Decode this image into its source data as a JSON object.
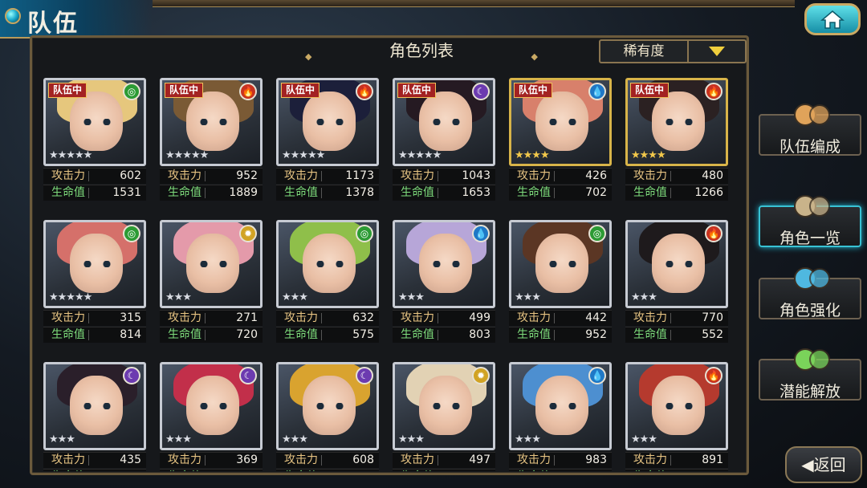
{
  "header": {
    "title": "队伍",
    "home_icon": "home-icon"
  },
  "panel": {
    "title": "角色列表",
    "sort": {
      "selected": "稀有度",
      "dropdown_icon": "triangle-down-icon"
    }
  },
  "labels": {
    "attack": "攻击力",
    "hp": "生命值",
    "in_team": "队伍中"
  },
  "colors": {
    "fire": "#c8321f",
    "wind": "#2c9b34",
    "water": "#1f78c6",
    "dark": "#6c3bb0",
    "light": "#d1a324"
  },
  "characters": [
    {
      "in_team": true,
      "element": "wind",
      "stars": 5,
      "frame": "silver",
      "atk": "602",
      "hp": "1531",
      "hair": "#e6c77d"
    },
    {
      "in_team": true,
      "element": "fire",
      "stars": 5,
      "frame": "silver",
      "atk": "952",
      "hp": "1889",
      "hair": "#7a5a35"
    },
    {
      "in_team": true,
      "element": "fire",
      "stars": 5,
      "frame": "silver",
      "atk": "1173",
      "hp": "1378",
      "hair": "#1c1f3a"
    },
    {
      "in_team": true,
      "element": "dark",
      "stars": 5,
      "frame": "silver",
      "atk": "1043",
      "hp": "1653",
      "hair": "#251a22"
    },
    {
      "in_team": true,
      "element": "water",
      "stars": 4,
      "frame": "gold",
      "atk": "426",
      "hp": "702",
      "hair": "#d8806b"
    },
    {
      "in_team": true,
      "element": "fire",
      "stars": 4,
      "frame": "gold",
      "atk": "480",
      "hp": "1266",
      "hair": "#2b2122"
    },
    {
      "in_team": false,
      "element": "wind",
      "stars": 5,
      "frame": "silver",
      "atk": "315",
      "hp": "814",
      "hair": "#d5706a"
    },
    {
      "in_team": false,
      "element": "light",
      "stars": 3,
      "frame": "silver",
      "atk": "271",
      "hp": "720",
      "hair": "#e49aaa"
    },
    {
      "in_team": false,
      "element": "wind",
      "stars": 3,
      "frame": "silver",
      "atk": "632",
      "hp": "575",
      "hair": "#8fbf4a"
    },
    {
      "in_team": false,
      "element": "water",
      "stars": 3,
      "frame": "silver",
      "atk": "499",
      "hp": "803",
      "hair": "#b7a6d8"
    },
    {
      "in_team": false,
      "element": "wind",
      "stars": 3,
      "frame": "silver",
      "atk": "442",
      "hp": "952",
      "hair": "#5b3624"
    },
    {
      "in_team": false,
      "element": "fire",
      "stars": 3,
      "frame": "silver",
      "atk": "770",
      "hp": "552",
      "hair": "#1e1a1c"
    },
    {
      "in_team": false,
      "element": "dark",
      "stars": 3,
      "frame": "silver",
      "atk": "435",
      "hp": "",
      "hair": "#2a1f2a"
    },
    {
      "in_team": false,
      "element": "dark",
      "stars": 3,
      "frame": "silver",
      "atk": "369",
      "hp": "",
      "hair": "#c22f4a"
    },
    {
      "in_team": false,
      "element": "dark",
      "stars": 3,
      "frame": "silver",
      "atk": "608",
      "hp": "",
      "hair": "#d9a32f"
    },
    {
      "in_team": false,
      "element": "light",
      "stars": 3,
      "frame": "silver",
      "atk": "497",
      "hp": "",
      "hair": "#e2d2b4"
    },
    {
      "in_team": false,
      "element": "water",
      "stars": 3,
      "frame": "silver",
      "atk": "983",
      "hp": "",
      "hair": "#4d8fd0"
    },
    {
      "in_team": false,
      "element": "fire",
      "stars": 3,
      "frame": "silver",
      "atk": "891",
      "hp": "",
      "hair": "#b53a2e"
    }
  ],
  "side_menu": [
    {
      "label": "队伍编成",
      "icon": "team-portraits-icon",
      "active": false
    },
    {
      "label": "角色一览",
      "icon": "open-book-icon",
      "active": true
    },
    {
      "label": "角色强化",
      "icon": "power-up-icon",
      "active": false
    },
    {
      "label": "潜能解放",
      "icon": "potential-orb-icon",
      "active": false
    }
  ],
  "back": {
    "label": "返回",
    "icon": "back-arrow-icon"
  }
}
